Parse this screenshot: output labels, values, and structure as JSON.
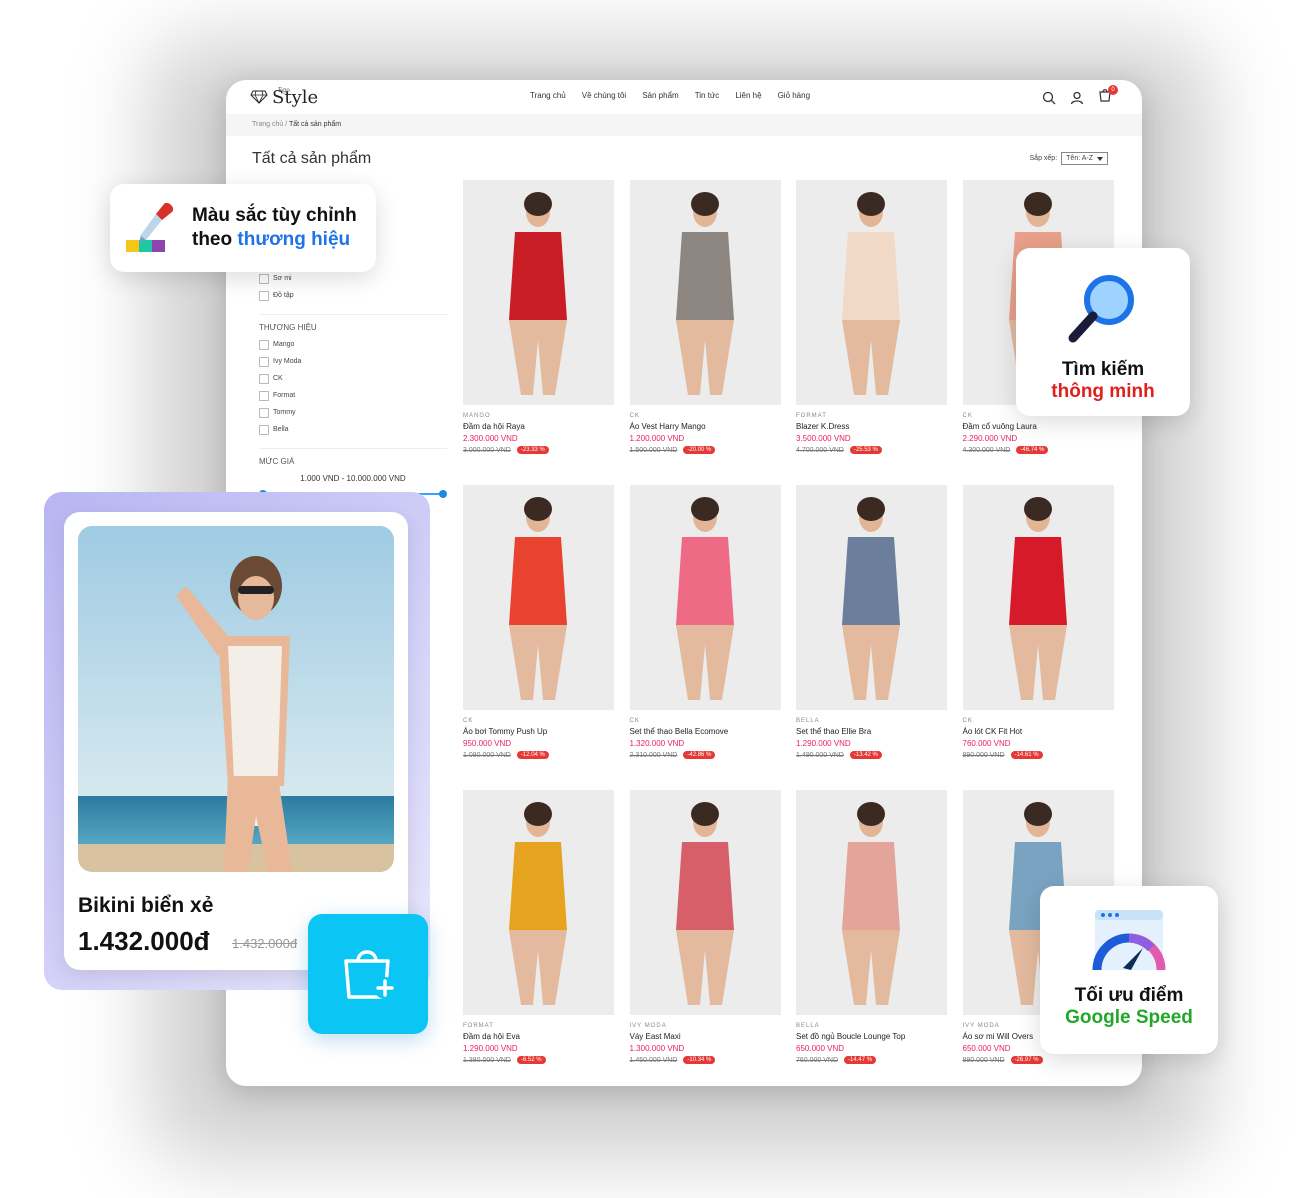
{
  "logo": {
    "text": "Style",
    "sub": "Ego"
  },
  "nav": [
    "Trang chủ",
    "Về chúng tôi",
    "Sản phẩm",
    "Tin tức",
    "Liên hệ",
    "Giỏ hàng"
  ],
  "cart_count": "0",
  "breadcrumb": {
    "home": "Trang chủ",
    "separator": "/",
    "current": "Tất cả sản phẩm"
  },
  "page_title": "Tất cả sản phẩm",
  "sort": {
    "label": "Sắp xếp:",
    "value": "Tên: A-Z"
  },
  "sidebar": {
    "categories": [
      "Sơ mi",
      "Đồ tập"
    ],
    "brand_heading": "THƯƠNG HIỆU",
    "brands": [
      "Mango",
      "Ivy Moda",
      "CK",
      "Format",
      "Tommy",
      "Bella"
    ],
    "price_heading": "MỨC GIÁ",
    "price_range": "1.000 VND - 10.000.000 VND",
    "price_min_fraction": 0,
    "price_max_fraction": 1
  },
  "products": [
    {
      "brand": "MANGO",
      "name": "Đầm dạ hội Raya",
      "price": "2.300.000 VND",
      "old": "3.000.000 VND",
      "discount": "-23.33 %"
    },
    {
      "brand": "CK",
      "name": "Áo Vest Harry Mango",
      "price": "1.200.000 VND",
      "old": "1.500.000 VND",
      "discount": "-20.00 %"
    },
    {
      "brand": "FORMAT",
      "name": "Blazer K.Dress",
      "price": "3.500.000 VND",
      "old": "4.700.000 VND",
      "discount": "-25.53 %"
    },
    {
      "brand": "CK",
      "name": "Đầm cổ vuông Laura",
      "price": "2.290.000 VND",
      "old": "4.300.000 VND",
      "discount": "-46.74 %"
    },
    {
      "brand": "CK",
      "name": "Áo bơi Tommy Push Up",
      "price": "950.000 VND",
      "old": "1.080.000 VND",
      "discount": "-12.04 %"
    },
    {
      "brand": "CK",
      "name": "Set thể thao Bella Ecomove",
      "price": "1.320.000 VND",
      "old": "2.310.000 VND",
      "discount": "-42.86 %"
    },
    {
      "brand": "BELLA",
      "name": "Set thể thao Ellie Bra",
      "price": "1.290.000 VND",
      "old": "1.490.000 VND",
      "discount": "-13.42 %"
    },
    {
      "brand": "CK",
      "name": "Áo lót CK Fit Hot",
      "price": "760.000 VND",
      "old": "890.000 VND",
      "discount": "-14.61 %"
    },
    {
      "brand": "FORMAT",
      "name": "Đầm dạ hội Eva",
      "price": "1.290.000 VND",
      "old": "1.380.000 VND",
      "discount": "-6.52 %"
    },
    {
      "brand": "IVY MODA",
      "name": "Váy East Maxi",
      "price": "1.300.000 VND",
      "old": "1.450.000 VND",
      "discount": "-10.34 %"
    },
    {
      "brand": "BELLA",
      "name": "Set đồ ngủ Boucle Lounge Top",
      "price": "650.000 VND",
      "old": "760.000 VND",
      "discount": "-14.47 %"
    },
    {
      "brand": "IVY MODA",
      "name": "Áo sơ mi Will Overs",
      "price": "650.000 VND",
      "old": "890.000 VND",
      "discount": "-26.97 %"
    }
  ],
  "product_colors": [
    "#c81d25",
    "#8d8580",
    "#f0d9c6",
    "#e8a08a",
    "#e8432f",
    "#ef6a85",
    "#6b7f9c",
    "#d61a2a",
    "#e6a31f",
    "#d65f6a",
    "#e3a49a",
    "#7aa3c2"
  ],
  "callouts": {
    "color": {
      "line1": "Màu sắc tùy chỉnh",
      "line2_prefix": "theo ",
      "line2_highlight": "thương hiệu"
    },
    "search": {
      "line1": "Tìm kiếm",
      "line2": "thông minh"
    },
    "speed": {
      "line1": "Tối ưu điểm",
      "line2": "Google Speed"
    }
  },
  "featured": {
    "name": "Bikini biển xẻ",
    "price": "1.432.000đ",
    "old_price": "1.432.000đ"
  },
  "colors": {
    "accent_blue": "#1e73e8",
    "accent_red": "#e0201f",
    "accent_green": "#22a829",
    "add_button": "#0bc6f5",
    "price_pink": "#e91e63"
  }
}
